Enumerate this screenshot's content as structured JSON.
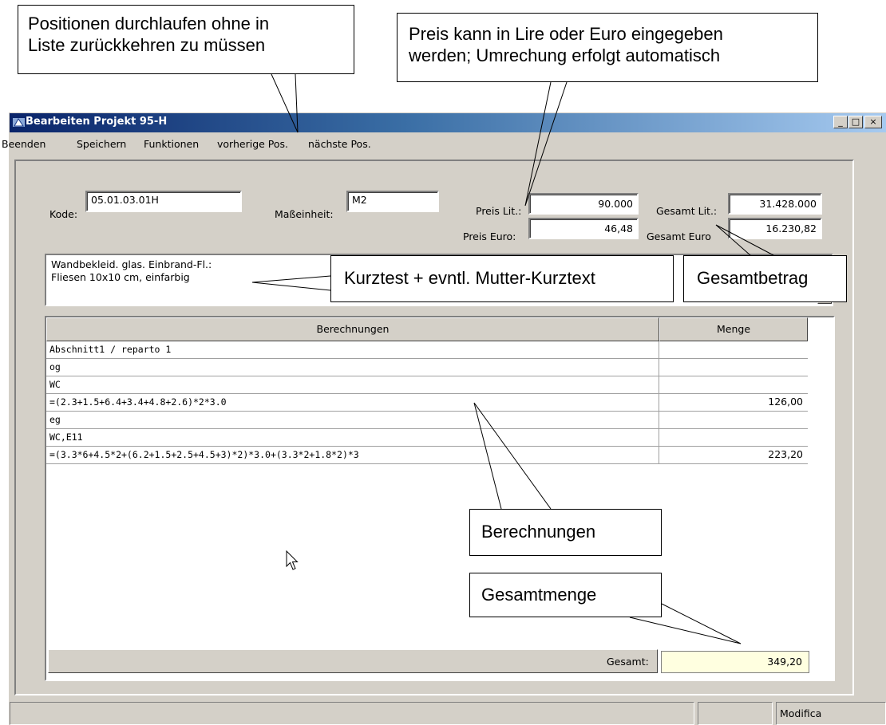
{
  "window": {
    "title": "Bearbeiten Projekt 95-H",
    "controls": {
      "minimize": "_",
      "maximize": "□",
      "close": "×"
    }
  },
  "menu": {
    "items": [
      "Beenden",
      "Speichern",
      "Funktionen",
      "vorherige Pos.",
      "nächste Pos."
    ]
  },
  "form": {
    "kode_label": "Kode:",
    "kode_value": "05.01.03.01H",
    "einheit_label": "Maßeinheit:",
    "einheit_value": "M2",
    "preis_lit_label": "Preis Lit.:",
    "preis_lit_value": "90.000",
    "preis_euro_label": "Preis Euro:",
    "preis_euro_value": "46,48",
    "gesamt_lit_label": "Gesamt Lit.:",
    "gesamt_lit_value": "31.428.000",
    "gesamt_euro_label": "Gesamt Euro",
    "gesamt_euro_value": "16.230,82",
    "kurztext_line1": "Wandbekleid. glas. Einbrand-Fl.:",
    "kurztext_line2": "Fliesen 10x10 cm, einfarbig"
  },
  "grid": {
    "headers": {
      "berechnungen": "Berechnungen",
      "menge": "Menge"
    },
    "rows": [
      {
        "berechnung": "Abschnitt1 / reparto 1",
        "menge": ""
      },
      {
        "berechnung": "og",
        "menge": ""
      },
      {
        "berechnung": "WC",
        "menge": ""
      },
      {
        "berechnung": "=(2.3+1.5+6.4+3.4+4.8+2.6)*2*3.0",
        "menge": "126,00"
      },
      {
        "berechnung": "eg",
        "menge": ""
      },
      {
        "berechnung": "WC,E11",
        "menge": ""
      },
      {
        "berechnung": "=(3.3*6+4.5*2+(6.2+1.5+2.5+4.5+3)*2)*3.0+(3.3*2+1.8*2)*3",
        "menge": "223,20"
      }
    ],
    "footer_label": "Gesamt:",
    "footer_total": "349,20"
  },
  "status": {
    "mode": "Modifica"
  },
  "callouts": {
    "navigation": {
      "line1": "Positionen durchlaufen ohne in",
      "line2": "Liste zurückkehren zu müssen"
    },
    "price": {
      "line1": "Preis kann in Lire oder Euro eingegeben",
      "line2": "werden; Umrechung erfolgt automatisch"
    },
    "kurztext": "Kurztest + evntl. Mutter-Kurztext",
    "gesamtbetrag": "Gesamtbetrag",
    "berechnungen": "Berechnungen",
    "gesamtmenge": "Gesamtmenge"
  }
}
